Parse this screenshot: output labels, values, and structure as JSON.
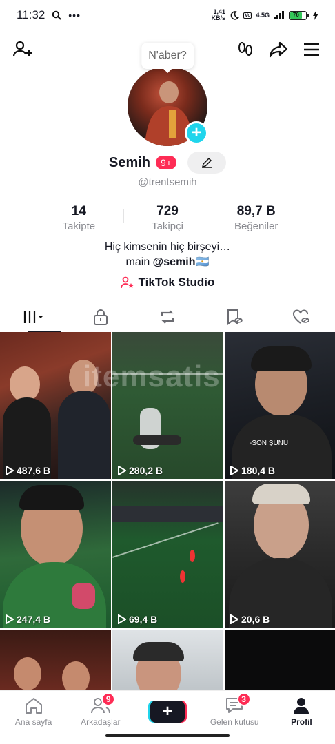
{
  "status_bar": {
    "time": "11:32",
    "net_speed_value": "1,41",
    "net_speed_unit": "KB/s",
    "network": "4.5G",
    "battery": "76"
  },
  "profile": {
    "note_bubble": "N'aber?",
    "name": "Semih",
    "notification_badge": "9+",
    "username": "@trentsemih",
    "stats": [
      {
        "value": "14",
        "label": "Takipte"
      },
      {
        "value": "729",
        "label": "Takipçi"
      },
      {
        "value": "89,7 B",
        "label": "Beğeniler"
      }
    ],
    "bio_line1": "Hiç kimsenin hiç birşeyi…",
    "bio_line2_prefix": "main ",
    "bio_line2_mention": "@semih",
    "bio_line2_flag": "🇦🇷",
    "studio_label": "TikTok Studio"
  },
  "tabs": [
    "videos-grid",
    "private",
    "reposts",
    "favorites",
    "liked"
  ],
  "videos": [
    {
      "views": "487,6 B"
    },
    {
      "views": "280,2 B"
    },
    {
      "views": "180,4 B"
    },
    {
      "views": "247,4 B"
    },
    {
      "views": "69,4 B"
    },
    {
      "views": "20,6 B"
    },
    {
      "views": ""
    },
    {
      "views": ""
    },
    {
      "views": ""
    }
  ],
  "video_overlay_text": "-SON ŞUNU",
  "watermark": "itemsatis",
  "bottom_nav": {
    "home": "Ana sayfa",
    "friends": "Arkadaşlar",
    "friends_badge": "9",
    "create": "+",
    "inbox": "Gelen kutusu",
    "inbox_badge": "3",
    "profile": "Profil"
  },
  "colors": {
    "accent_red": "#fe2c55",
    "accent_cyan": "#20d5ec",
    "text_primary": "#161823",
    "text_secondary": "#8a8b91"
  }
}
